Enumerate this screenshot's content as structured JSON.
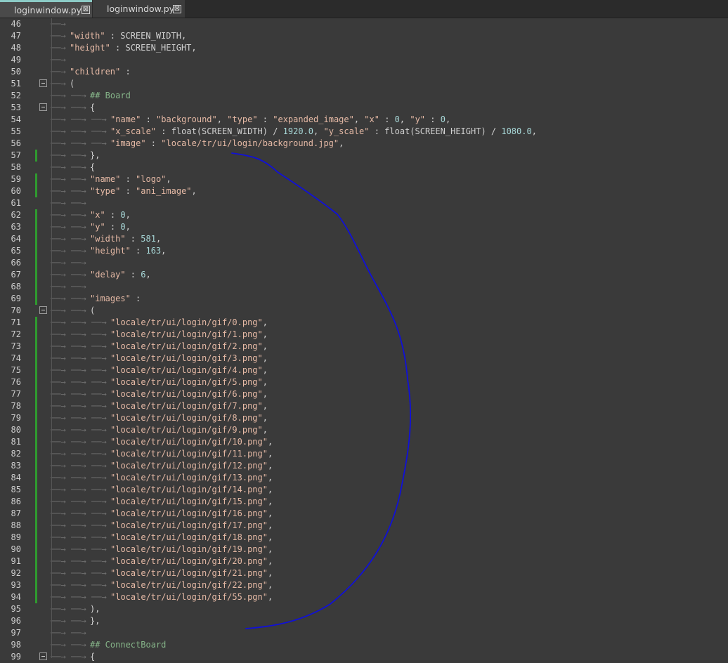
{
  "tabs": [
    {
      "name": "loginwindow.py",
      "close": "⊠"
    },
    {
      "name": "loginwindow.py",
      "close": "⊠"
    }
  ],
  "lines": [
    {
      "n": "46",
      "indent": 1,
      "fold": false,
      "mod": false,
      "parts": []
    },
    {
      "n": "47",
      "indent": 1,
      "fold": false,
      "mod": false,
      "parts": [
        {
          "t": "\"width\"",
          "c": "str"
        },
        {
          "t": " : SCREEN_WIDTH,",
          "c": "sym"
        }
      ]
    },
    {
      "n": "48",
      "indent": 1,
      "fold": false,
      "mod": false,
      "parts": [
        {
          "t": "\"height\"",
          "c": "str"
        },
        {
          "t": " : SCREEN_HEIGHT,",
          "c": "sym"
        }
      ]
    },
    {
      "n": "49",
      "indent": 1,
      "fold": false,
      "mod": false,
      "parts": []
    },
    {
      "n": "50",
      "indent": 1,
      "fold": false,
      "mod": false,
      "parts": [
        {
          "t": "\"children\"",
          "c": "str"
        },
        {
          "t": " :",
          "c": "sym"
        }
      ]
    },
    {
      "n": "51",
      "indent": 1,
      "fold": true,
      "mod": false,
      "parts": [
        {
          "t": "(",
          "c": "sym"
        }
      ]
    },
    {
      "n": "52",
      "indent": 2,
      "fold": false,
      "mod": false,
      "parts": [
        {
          "t": "## Board",
          "c": "cmt"
        }
      ]
    },
    {
      "n": "53",
      "indent": 2,
      "fold": true,
      "mod": false,
      "parts": [
        {
          "t": "{",
          "c": "sym"
        }
      ]
    },
    {
      "n": "54",
      "indent": 3,
      "fold": false,
      "mod": false,
      "parts": [
        {
          "t": "\"name\"",
          "c": "str"
        },
        {
          "t": " : ",
          "c": "sym"
        },
        {
          "t": "\"background\"",
          "c": "str"
        },
        {
          "t": ", ",
          "c": "sym"
        },
        {
          "t": "\"type\"",
          "c": "str"
        },
        {
          "t": " : ",
          "c": "sym"
        },
        {
          "t": "\"expanded_image\"",
          "c": "str"
        },
        {
          "t": ", ",
          "c": "sym"
        },
        {
          "t": "\"x\"",
          "c": "str"
        },
        {
          "t": " : ",
          "c": "sym"
        },
        {
          "t": "0",
          "c": "num"
        },
        {
          "t": ", ",
          "c": "sym"
        },
        {
          "t": "\"y\"",
          "c": "str"
        },
        {
          "t": " : ",
          "c": "sym"
        },
        {
          "t": "0",
          "c": "num"
        },
        {
          "t": ",",
          "c": "sym"
        }
      ]
    },
    {
      "n": "55",
      "indent": 3,
      "fold": false,
      "mod": false,
      "parts": [
        {
          "t": "\"x_scale\"",
          "c": "str"
        },
        {
          "t": " : float(SCREEN_WIDTH) / ",
          "c": "sym"
        },
        {
          "t": "1920.0",
          "c": "num"
        },
        {
          "t": ", ",
          "c": "sym"
        },
        {
          "t": "\"y_scale\"",
          "c": "str"
        },
        {
          "t": " : float(SCREEN_HEIGHT) / ",
          "c": "sym"
        },
        {
          "t": "1080.0",
          "c": "num"
        },
        {
          "t": ",",
          "c": "sym"
        }
      ]
    },
    {
      "n": "56",
      "indent": 3,
      "fold": false,
      "mod": false,
      "parts": [
        {
          "t": "\"image\"",
          "c": "str"
        },
        {
          "t": " : ",
          "c": "sym"
        },
        {
          "t": "\"locale/tr/ui/login/background.jpg\"",
          "c": "str"
        },
        {
          "t": ",",
          "c": "sym"
        }
      ]
    },
    {
      "n": "57",
      "indent": 2,
      "fold": false,
      "mod": true,
      "parts": [
        {
          "t": "},",
          "c": "sym"
        }
      ]
    },
    {
      "n": "58",
      "indent": 2,
      "fold": false,
      "mod": false,
      "parts": [
        {
          "t": "{",
          "c": "sym"
        }
      ]
    },
    {
      "n": "59",
      "indent": 2,
      "fold": false,
      "mod": true,
      "parts": [
        {
          "t": "\"name\"",
          "c": "str"
        },
        {
          "t": " : ",
          "c": "sym"
        },
        {
          "t": "\"logo\"",
          "c": "str"
        },
        {
          "t": ",",
          "c": "sym"
        }
      ]
    },
    {
      "n": "60",
      "indent": 2,
      "fold": false,
      "mod": true,
      "parts": [
        {
          "t": "\"type\"",
          "c": "str"
        },
        {
          "t": " : ",
          "c": "sym"
        },
        {
          "t": "\"ani_image\"",
          "c": "str"
        },
        {
          "t": ",",
          "c": "sym"
        }
      ]
    },
    {
      "n": "61",
      "indent": 2,
      "fold": false,
      "mod": false,
      "parts": []
    },
    {
      "n": "62",
      "indent": 2,
      "fold": false,
      "mod": true,
      "parts": [
        {
          "t": "\"x\"",
          "c": "str"
        },
        {
          "t": " : ",
          "c": "sym"
        },
        {
          "t": "0",
          "c": "num"
        },
        {
          "t": ",",
          "c": "sym"
        }
      ]
    },
    {
      "n": "63",
      "indent": 2,
      "fold": false,
      "mod": true,
      "parts": [
        {
          "t": "\"y\"",
          "c": "str"
        },
        {
          "t": " : ",
          "c": "sym"
        },
        {
          "t": "0",
          "c": "num"
        },
        {
          "t": ",",
          "c": "sym"
        }
      ]
    },
    {
      "n": "64",
      "indent": 2,
      "fold": false,
      "mod": true,
      "parts": [
        {
          "t": "\"width\"",
          "c": "str"
        },
        {
          "t": " : ",
          "c": "sym"
        },
        {
          "t": "581",
          "c": "num"
        },
        {
          "t": ",",
          "c": "sym"
        }
      ]
    },
    {
      "n": "65",
      "indent": 2,
      "fold": false,
      "mod": true,
      "parts": [
        {
          "t": "\"height\"",
          "c": "str"
        },
        {
          "t": " : ",
          "c": "sym"
        },
        {
          "t": "163",
          "c": "num"
        },
        {
          "t": ",",
          "c": "sym"
        }
      ]
    },
    {
      "n": "66",
      "indent": 2,
      "fold": false,
      "mod": true,
      "parts": []
    },
    {
      "n": "67",
      "indent": 2,
      "fold": false,
      "mod": true,
      "parts": [
        {
          "t": "\"delay\"",
          "c": "str"
        },
        {
          "t": " : ",
          "c": "sym"
        },
        {
          "t": "6",
          "c": "num"
        },
        {
          "t": ",",
          "c": "sym"
        }
      ]
    },
    {
      "n": "68",
      "indent": 2,
      "fold": false,
      "mod": true,
      "parts": []
    },
    {
      "n": "69",
      "indent": 2,
      "fold": false,
      "mod": true,
      "parts": [
        {
          "t": "\"images\"",
          "c": "str"
        },
        {
          "t": " :",
          "c": "sym"
        }
      ]
    },
    {
      "n": "70",
      "indent": 2,
      "fold": true,
      "mod": false,
      "parts": [
        {
          "t": "(",
          "c": "sym"
        }
      ]
    },
    {
      "n": "71",
      "indent": 3,
      "fold": false,
      "mod": true,
      "parts": [
        {
          "t": "\"locale/tr/ui/login/gif/0.png\"",
          "c": "str"
        },
        {
          "t": ",",
          "c": "sym"
        }
      ]
    },
    {
      "n": "72",
      "indent": 3,
      "fold": false,
      "mod": true,
      "parts": [
        {
          "t": "\"locale/tr/ui/login/gif/1.png\"",
          "c": "str"
        },
        {
          "t": ",",
          "c": "sym"
        }
      ]
    },
    {
      "n": "73",
      "indent": 3,
      "fold": false,
      "mod": true,
      "parts": [
        {
          "t": "\"locale/tr/ui/login/gif/2.png\"",
          "c": "str"
        },
        {
          "t": ",",
          "c": "sym"
        }
      ]
    },
    {
      "n": "74",
      "indent": 3,
      "fold": false,
      "mod": true,
      "parts": [
        {
          "t": "\"locale/tr/ui/login/gif/3.png\"",
          "c": "str"
        },
        {
          "t": ",",
          "c": "sym"
        }
      ]
    },
    {
      "n": "75",
      "indent": 3,
      "fold": false,
      "mod": true,
      "parts": [
        {
          "t": "\"locale/tr/ui/login/gif/4.png\"",
          "c": "str"
        },
        {
          "t": ",",
          "c": "sym"
        }
      ]
    },
    {
      "n": "76",
      "indent": 3,
      "fold": false,
      "mod": true,
      "parts": [
        {
          "t": "\"locale/tr/ui/login/gif/5.png\"",
          "c": "str"
        },
        {
          "t": ",",
          "c": "sym"
        }
      ]
    },
    {
      "n": "77",
      "indent": 3,
      "fold": false,
      "mod": true,
      "parts": [
        {
          "t": "\"locale/tr/ui/login/gif/6.png\"",
          "c": "str"
        },
        {
          "t": ",",
          "c": "sym"
        }
      ]
    },
    {
      "n": "78",
      "indent": 3,
      "fold": false,
      "mod": true,
      "parts": [
        {
          "t": "\"locale/tr/ui/login/gif/7.png\"",
          "c": "str"
        },
        {
          "t": ",",
          "c": "sym"
        }
      ]
    },
    {
      "n": "79",
      "indent": 3,
      "fold": false,
      "mod": true,
      "parts": [
        {
          "t": "\"locale/tr/ui/login/gif/8.png\"",
          "c": "str"
        },
        {
          "t": ",",
          "c": "sym"
        }
      ]
    },
    {
      "n": "80",
      "indent": 3,
      "fold": false,
      "mod": true,
      "parts": [
        {
          "t": "\"locale/tr/ui/login/gif/9.png\"",
          "c": "str"
        },
        {
          "t": ",",
          "c": "sym"
        }
      ]
    },
    {
      "n": "81",
      "indent": 3,
      "fold": false,
      "mod": true,
      "parts": [
        {
          "t": "\"locale/tr/ui/login/gif/10.png\"",
          "c": "str"
        },
        {
          "t": ",",
          "c": "sym"
        }
      ]
    },
    {
      "n": "82",
      "indent": 3,
      "fold": false,
      "mod": true,
      "parts": [
        {
          "t": "\"locale/tr/ui/login/gif/11.png\"",
          "c": "str"
        },
        {
          "t": ",",
          "c": "sym"
        }
      ]
    },
    {
      "n": "83",
      "indent": 3,
      "fold": false,
      "mod": true,
      "parts": [
        {
          "t": "\"locale/tr/ui/login/gif/12.png\"",
          "c": "str"
        },
        {
          "t": ",",
          "c": "sym"
        }
      ]
    },
    {
      "n": "84",
      "indent": 3,
      "fold": false,
      "mod": true,
      "parts": [
        {
          "t": "\"locale/tr/ui/login/gif/13.png\"",
          "c": "str"
        },
        {
          "t": ",",
          "c": "sym"
        }
      ]
    },
    {
      "n": "85",
      "indent": 3,
      "fold": false,
      "mod": true,
      "parts": [
        {
          "t": "\"locale/tr/ui/login/gif/14.png\"",
          "c": "str"
        },
        {
          "t": ",",
          "c": "sym"
        }
      ]
    },
    {
      "n": "86",
      "indent": 3,
      "fold": false,
      "mod": true,
      "parts": [
        {
          "t": "\"locale/tr/ui/login/gif/15.png\"",
          "c": "str"
        },
        {
          "t": ",",
          "c": "sym"
        }
      ]
    },
    {
      "n": "87",
      "indent": 3,
      "fold": false,
      "mod": true,
      "parts": [
        {
          "t": "\"locale/tr/ui/login/gif/16.png\"",
          "c": "str"
        },
        {
          "t": ",",
          "c": "sym"
        }
      ]
    },
    {
      "n": "88",
      "indent": 3,
      "fold": false,
      "mod": true,
      "parts": [
        {
          "t": "\"locale/tr/ui/login/gif/17.png\"",
          "c": "str"
        },
        {
          "t": ",",
          "c": "sym"
        }
      ]
    },
    {
      "n": "89",
      "indent": 3,
      "fold": false,
      "mod": true,
      "parts": [
        {
          "t": "\"locale/tr/ui/login/gif/18.png\"",
          "c": "str"
        },
        {
          "t": ",",
          "c": "sym"
        }
      ]
    },
    {
      "n": "90",
      "indent": 3,
      "fold": false,
      "mod": true,
      "parts": [
        {
          "t": "\"locale/tr/ui/login/gif/19.png\"",
          "c": "str"
        },
        {
          "t": ",",
          "c": "sym"
        }
      ]
    },
    {
      "n": "91",
      "indent": 3,
      "fold": false,
      "mod": true,
      "parts": [
        {
          "t": "\"locale/tr/ui/login/gif/20.png\"",
          "c": "str"
        },
        {
          "t": ",",
          "c": "sym"
        }
      ]
    },
    {
      "n": "92",
      "indent": 3,
      "fold": false,
      "mod": true,
      "parts": [
        {
          "t": "\"locale/tr/ui/login/gif/21.png\"",
          "c": "str"
        },
        {
          "t": ",",
          "c": "sym"
        }
      ]
    },
    {
      "n": "93",
      "indent": 3,
      "fold": false,
      "mod": true,
      "parts": [
        {
          "t": "\"locale/tr/ui/login/gif/22.png\"",
          "c": "str"
        },
        {
          "t": ",",
          "c": "sym"
        }
      ]
    },
    {
      "n": "94",
      "indent": 3,
      "fold": false,
      "mod": true,
      "parts": [
        {
          "t": "\"locale/tr/ui/login/gif/55.pgn\"",
          "c": "str"
        },
        {
          "t": ",",
          "c": "sym"
        }
      ]
    },
    {
      "n": "95",
      "indent": 2,
      "fold": false,
      "mod": false,
      "parts": [
        {
          "t": "),",
          "c": "sym"
        }
      ]
    },
    {
      "n": "96",
      "indent": 2,
      "fold": false,
      "mod": false,
      "parts": [
        {
          "t": "},",
          "c": "sym"
        }
      ]
    },
    {
      "n": "97",
      "indent": 2,
      "fold": false,
      "mod": false,
      "parts": []
    },
    {
      "n": "98",
      "indent": 2,
      "fold": false,
      "mod": false,
      "parts": [
        {
          "t": "## ConnectBoard",
          "c": "cmt"
        }
      ]
    },
    {
      "n": "99",
      "indent": 2,
      "fold": true,
      "mod": false,
      "parts": [
        {
          "t": "{",
          "c": "sym"
        }
      ]
    }
  ],
  "colors": {
    "background": "#3a3a3a",
    "string": "#e5b9a5",
    "number": "#a8d8d8",
    "comment": "#86b589",
    "modified_marker": "#2f9a2f",
    "annotation_stroke": "#1010d8",
    "active_tab_accent": "#8ccbc6"
  }
}
